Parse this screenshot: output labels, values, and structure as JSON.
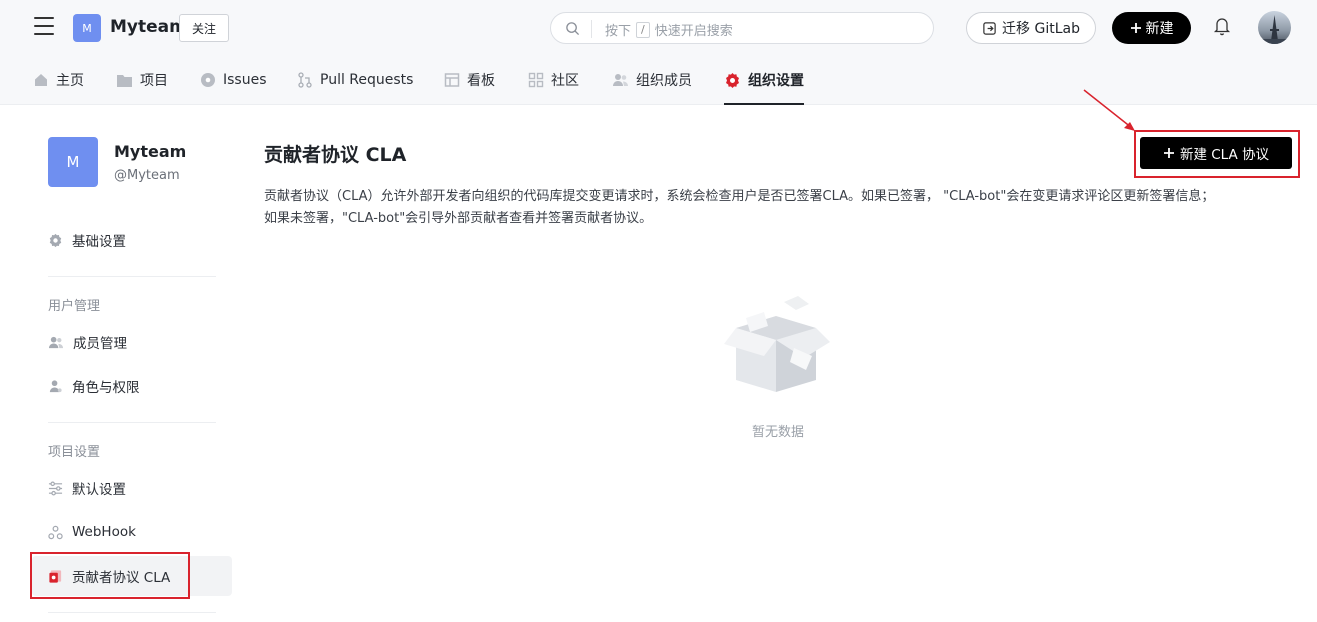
{
  "header": {
    "org_initial": "M",
    "org_name": "Myteam",
    "follow_label": "关注",
    "search_ph_before": "按下",
    "search_kbd": "/",
    "search_ph_after": "快速开启搜索",
    "migrate_label": "迁移 GitLab",
    "new_label": "新建"
  },
  "tabs": [
    {
      "label": "主页",
      "icon": "home-icon"
    },
    {
      "label": "项目",
      "icon": "folder-icon"
    },
    {
      "label": "Issues",
      "icon": "issues-icon"
    },
    {
      "label": "Pull Requests",
      "icon": "pull-request-icon"
    },
    {
      "label": "看板",
      "icon": "board-icon"
    },
    {
      "label": "社区",
      "icon": "community-icon"
    },
    {
      "label": "组织成员",
      "icon": "members-icon"
    },
    {
      "label": "组织设置",
      "icon": "settings-gear-icon",
      "active": true
    }
  ],
  "sidebar": {
    "org_initial": "M",
    "org_name": "Myteam",
    "org_handle": "@Myteam",
    "basic_settings": "基础设置",
    "group_user": "用户管理",
    "members": "成员管理",
    "roles": "角色与权限",
    "group_project": "项目设置",
    "defaults": "默认设置",
    "webhook": "WebHook",
    "cla": "贡献者协议 CLA"
  },
  "main": {
    "title": "贡献者协议 CLA",
    "desc_line1": "贡献者协议（CLA）允许外部开发者向组织的代码库提交变更请求时，系统会检查用户是否已签署CLA。如果已签署， \"CLA-bot\"会在变更请求评论区更新签署信息；",
    "desc_line2": "如果未签署，\"CLA-bot\"会引导外部贡献者查看并签署贡献者协议。",
    "new_cla_label": "新建 CLA 协议",
    "empty_text": "暂无数据"
  },
  "colors": {
    "accent_black": "#000000",
    "highlight_red": "#d9232d",
    "org_avatar": "#6f8ff0",
    "active_tab_icon": "#d9232d"
  }
}
